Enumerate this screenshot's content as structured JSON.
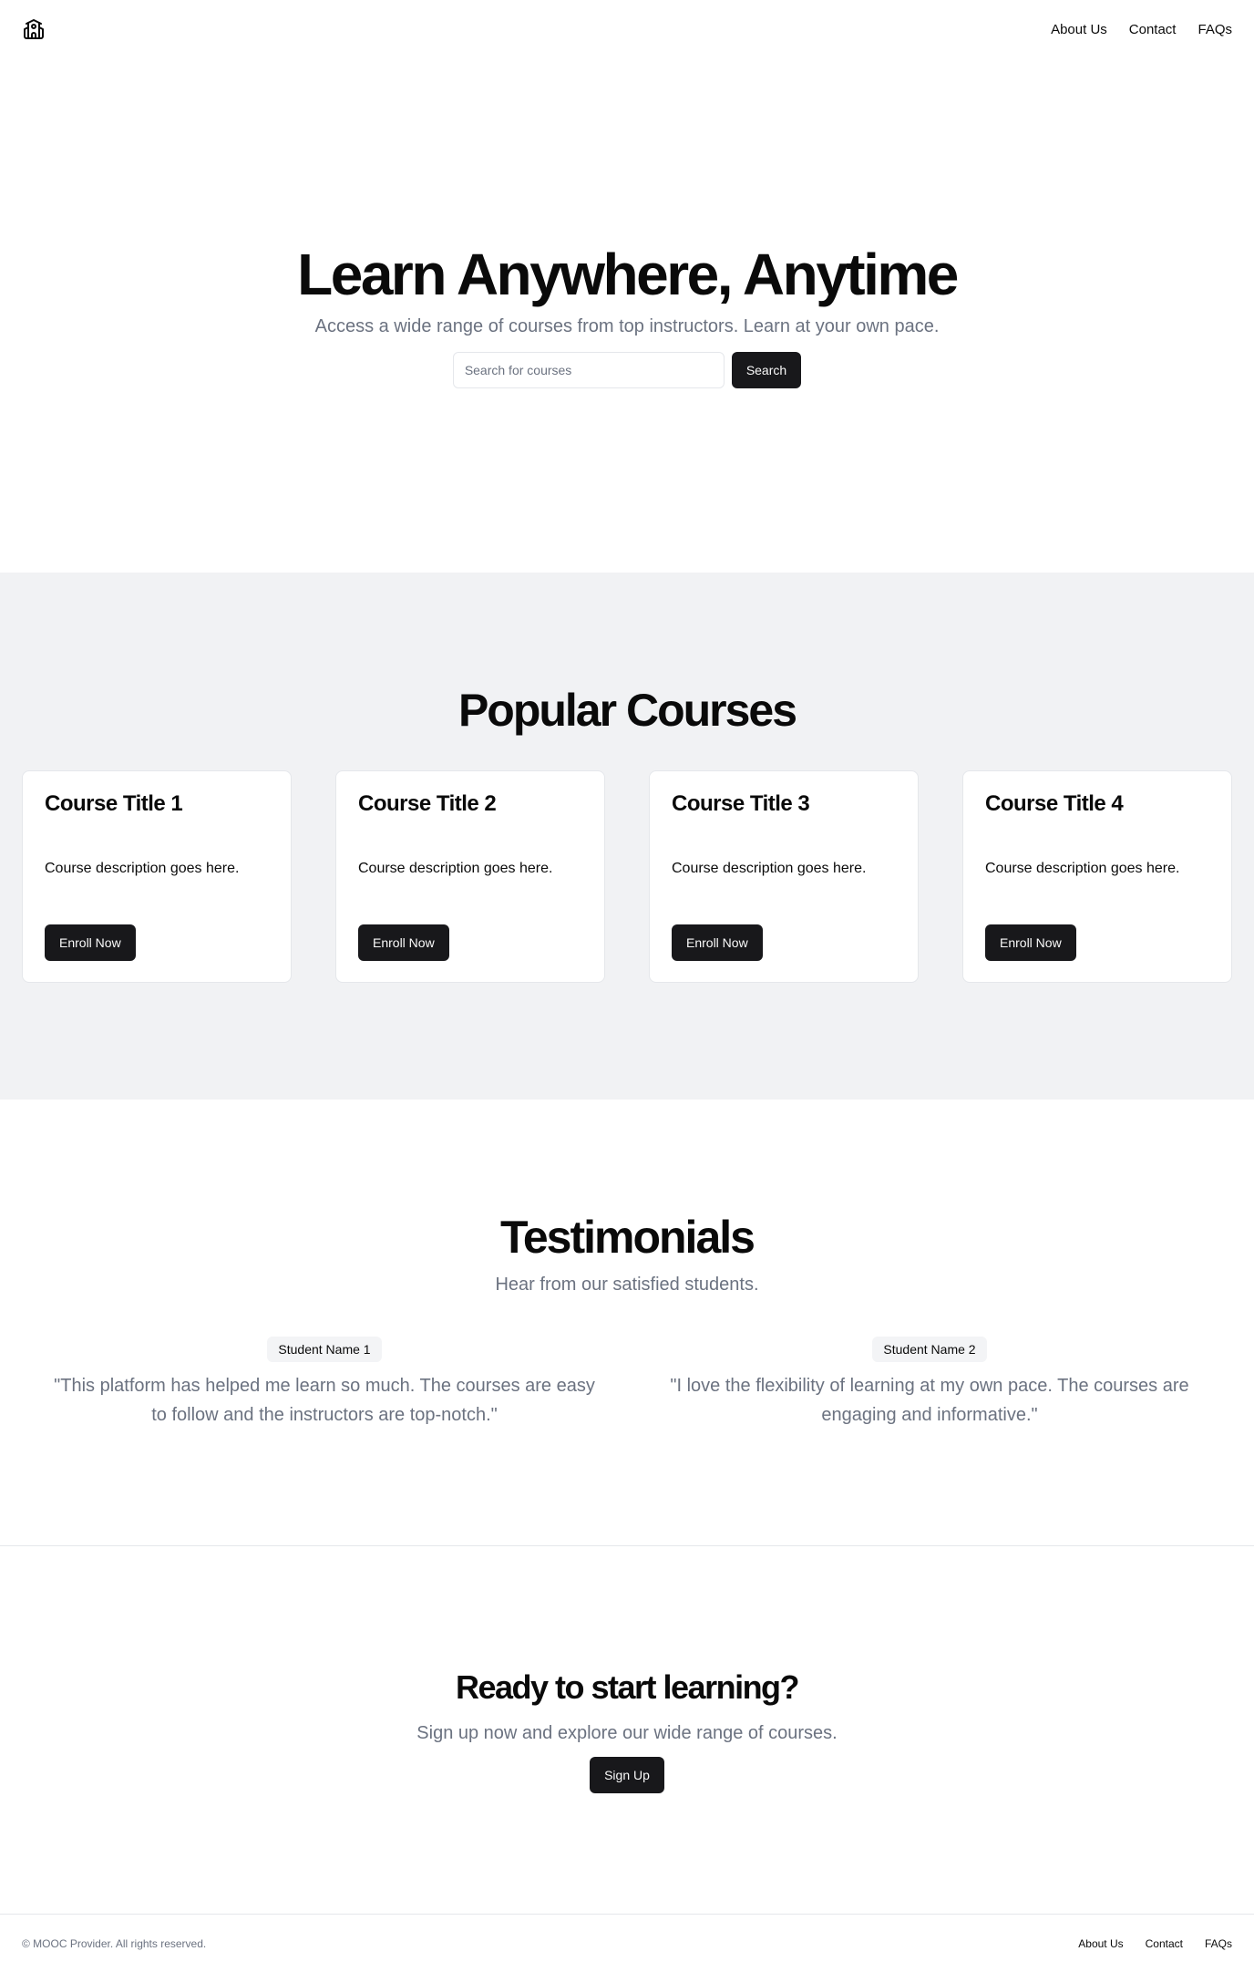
{
  "header": {
    "logo_icon": "school-icon",
    "nav": [
      "About Us",
      "Contact",
      "FAQs"
    ]
  },
  "hero": {
    "title": "Learn Anywhere, Anytime",
    "subtitle": "Access a wide range of courses from top instructors. Learn at your own pace.",
    "search_placeholder": "Search for courses",
    "search_value": "",
    "search_button": "Search"
  },
  "courses": {
    "heading": "Popular Courses",
    "items": [
      {
        "title": "Course Title 1",
        "description": "Course description goes here.",
        "button": "Enroll Now"
      },
      {
        "title": "Course Title 2",
        "description": "Course description goes here.",
        "button": "Enroll Now"
      },
      {
        "title": "Course Title 3",
        "description": "Course description goes here.",
        "button": "Enroll Now"
      },
      {
        "title": "Course Title 4",
        "description": "Course description goes here.",
        "button": "Enroll Now"
      }
    ]
  },
  "testimonials": {
    "heading": "Testimonials",
    "subtitle": "Hear from our satisfied students.",
    "items": [
      {
        "name": "Student Name 1",
        "quote": "\"This platform has helped me learn so much. The courses are easy to follow and the instructors are top-notch.\""
      },
      {
        "name": "Student Name 2",
        "quote": "\"I love the flexibility of learning at my own pace. The courses are engaging and informative.\""
      }
    ]
  },
  "cta": {
    "heading": "Ready to start learning?",
    "subtitle": "Sign up now and explore our wide range of courses.",
    "button": "Sign Up"
  },
  "footer": {
    "copyright": "© MOOC Provider. All rights reserved.",
    "nav": [
      "About Us",
      "Contact",
      "FAQs"
    ]
  },
  "colors": {
    "primary": "#18181b",
    "muted_text": "#6b7280",
    "section_bg": "#f1f2f4",
    "border": "#e5e7eb"
  }
}
